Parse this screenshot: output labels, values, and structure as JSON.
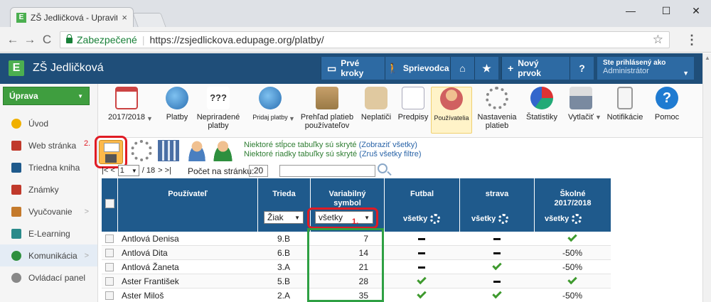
{
  "browser": {
    "tab_title": "ZŠ Jedličková - Upraviť v",
    "tab_close": "×",
    "win_min": "—",
    "win_max": "☐",
    "win_close": "✕",
    "back": "←",
    "forward": "→",
    "reload": "C",
    "secure_label": "Zabezpečené",
    "url": "https://zsjedlickova.edupage.org/platby/",
    "star": "☆",
    "menu": "⋮"
  },
  "header": {
    "logo": "E",
    "school_name": "ZŠ Jedličková",
    "buttons": [
      {
        "icon": "▭",
        "label": "Prvé kroky"
      },
      {
        "icon": "🚶",
        "label": "Sprievodca"
      },
      {
        "icon": "⌂",
        "label": ""
      },
      {
        "icon": "★",
        "label": ""
      },
      {
        "icon": "+",
        "label": "Nový prvok"
      },
      {
        "icon": "?",
        "label": ""
      }
    ],
    "user_caption": "Ste prihlásený ako",
    "user_role": "Administrátor"
  },
  "sidebar": {
    "main_button": "Úprava",
    "items": [
      {
        "label": "Úvod",
        "color": "#f0b000"
      },
      {
        "label": "Web stránka",
        "color": "#c0392b"
      },
      {
        "label": "Triedna kniha",
        "color": "#1f5a8c"
      },
      {
        "label": "Známky",
        "color": "#c0392b"
      },
      {
        "label": "Vyučovanie",
        "color": "#c47a2c"
      },
      {
        "label": "E-Learning",
        "color": "#2a8a8a"
      },
      {
        "label": "Komunikácia",
        "color": "#2e8f3e"
      },
      {
        "label": "Ovládací panel",
        "color": "#888888"
      }
    ]
  },
  "toolbar": {
    "items": [
      {
        "label": "2017/2018",
        "icon": "calendar-icon"
      },
      {
        "label": "Platby",
        "icon": "globe-icon"
      },
      {
        "label": "Nepriradené\nplatby",
        "icon": "question-icon"
      },
      {
        "label": "Pridaj platby",
        "icon": "add-payment-icon"
      },
      {
        "label": "Prehľad platieb\npoužívateľov",
        "icon": "boxes-icon"
      },
      {
        "label": "Neplatiči",
        "icon": "moneybag-icon"
      },
      {
        "label": "Predpisy",
        "icon": "notes-icon"
      },
      {
        "label": "Používatelia",
        "icon": "users-icon"
      },
      {
        "label": "Nastavenia\nplatieb",
        "icon": "gear-icon"
      },
      {
        "label": "Štatistiky",
        "icon": "pie-chart-icon"
      },
      {
        "label": "Vytlačiť",
        "icon": "print-icon"
      },
      {
        "label": "Notifikácie",
        "icon": "phone-icon"
      },
      {
        "label": "Pomoc",
        "icon": "help-icon"
      }
    ],
    "calendar_dropdown": "▼",
    "print_dropdown": "▼",
    "add_payment_dropdown": "▼",
    "q_marks": "???",
    "help_mark": "?"
  },
  "actions": {
    "annotation_2": "2.",
    "hidden_columns": "Niektoré stĺpce tabuľky sú skryté",
    "show_all": "(Zobraziť všetky)",
    "hidden_rows": "Niektoré riadky tabuľky sú skryté",
    "clear_filters": "(Zruš všetky filtre)"
  },
  "pager": {
    "first_prev": "|< <",
    "page": "1",
    "of": "/ 18",
    "next_last": "> >|",
    "per_page_label": "Počet na stránku:",
    "per_page_value": "20",
    "search_value": ""
  },
  "table": {
    "headers": {
      "user": "Používateľ",
      "class": "Trieda",
      "vs_line1": "Variabilný",
      "vs_line2": "symbol",
      "football": "Futbal",
      "food": "strava",
      "fees_line1": "Školné",
      "fees_line2": "2017/2018"
    },
    "filters": {
      "class": "Žiak",
      "vs": "všetky",
      "football": "všetky",
      "food": "všetky",
      "fees": "všetky"
    },
    "annotation_1": "1.",
    "rows": [
      {
        "name": "Antlová Denisa",
        "class": "9.B",
        "vs": "7",
        "football": "dash",
        "food": "dash",
        "fees": "check"
      },
      {
        "name": "Antlová Dita",
        "class": "6.B",
        "vs": "14",
        "football": "dash",
        "food": "dash",
        "fees": "-50%"
      },
      {
        "name": "Antlová Žaneta",
        "class": "3.A",
        "vs": "21",
        "football": "dash",
        "food": "check",
        "fees": "-50%"
      },
      {
        "name": "Aster František",
        "class": "5.B",
        "vs": "28",
        "football": "check",
        "food": "dash",
        "fees": "check"
      },
      {
        "name": "Aster Miloš",
        "class": "2.A",
        "vs": "35",
        "football": "check",
        "food": "check",
        "fees": "-50%"
      }
    ]
  }
}
